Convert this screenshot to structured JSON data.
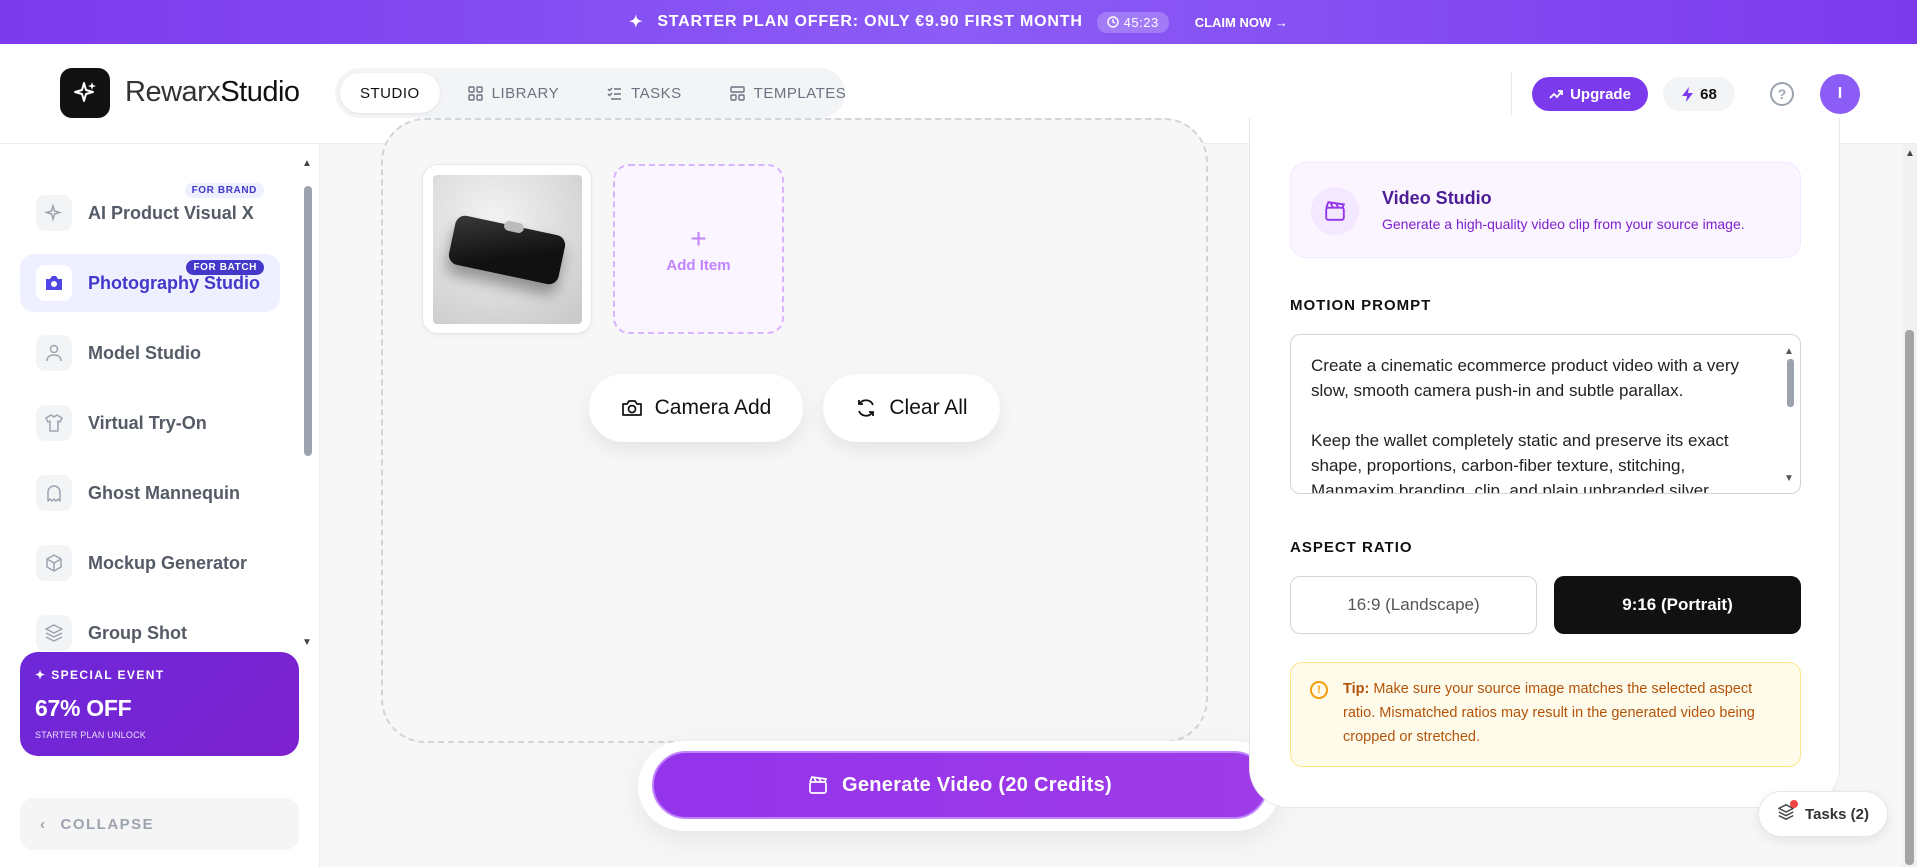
{
  "banner": {
    "offer_text": "STARTER PLAN OFFER: ONLY €9.90 FIRST MONTH",
    "timer": "45:23",
    "claim": "CLAIM NOW →"
  },
  "header": {
    "logo_light": "Rewarx",
    "logo_bold": "Studio",
    "nav": [
      {
        "label": "STUDIO",
        "icon": "none",
        "active": true
      },
      {
        "label": "LIBRARY",
        "icon": "grid-icon",
        "active": false
      },
      {
        "label": "TASKS",
        "icon": "checklist-icon",
        "active": false
      },
      {
        "label": "TEMPLATES",
        "icon": "layout-icon",
        "active": false
      }
    ],
    "upgrade": "Upgrade",
    "credits": "68",
    "help": "?",
    "avatar": "I"
  },
  "sidebar": {
    "items": [
      {
        "label": "AI Product Visual X",
        "badge": "FOR BRAND",
        "icon": "sparkle-icon",
        "active": false
      },
      {
        "label": "Photography Studio",
        "badge": "FOR BATCH",
        "icon": "camera-icon",
        "active": true
      },
      {
        "label": "Model Studio",
        "badge": "",
        "icon": "person-icon",
        "active": false
      },
      {
        "label": "Virtual Try-On",
        "badge": "",
        "icon": "shirt-icon",
        "active": false
      },
      {
        "label": "Ghost Mannequin",
        "badge": "",
        "icon": "ghost-icon",
        "active": false
      },
      {
        "label": "Mockup Generator",
        "badge": "",
        "icon": "box-icon",
        "active": false
      },
      {
        "label": "Group Shot",
        "badge": "",
        "icon": "layers-icon",
        "active": false
      }
    ],
    "event": {
      "tag": "SPECIAL EVENT",
      "headline": "67% OFF",
      "sub": "STARTER PLAN UNLOCK"
    },
    "collapse": "COLLAPSE"
  },
  "workspace": {
    "add_item": "Add Item",
    "camera_add": "Camera Add",
    "clear_all": "Clear All",
    "generate": "Generate Video (20 Credits)"
  },
  "panel": {
    "title": "Video Studio",
    "subtitle": "Generate a high-quality video clip from your source image.",
    "motion_label": "MOTION PROMPT",
    "prompt_p1": "Create a cinematic ecommerce product video with a very slow, smooth camera push-in and subtle parallax.",
    "prompt_p2": "Keep the wallet completely static and preserve its exact shape, proportions, carbon-fiber texture, stitching, Manmaxim branding, clip, and plain unbranded silver",
    "aspect_label": "ASPECT RATIO",
    "aspect_options": [
      {
        "label": "16:9 (Landscape)",
        "selected": false
      },
      {
        "label": "9:16 (Portrait)",
        "selected": true
      }
    ],
    "tip_bold": "Tip:",
    "tip_text": " Make sure your source image matches the selected aspect ratio. Mismatched ratios may result in the generated video being cropped or stretched."
  },
  "tasks_fab": "Tasks (2)",
  "colors": {
    "accent": "#7c3aed",
    "generate": "#9333ea",
    "active_nav": "#4338ca",
    "tip_bg": "#fffbeb"
  }
}
